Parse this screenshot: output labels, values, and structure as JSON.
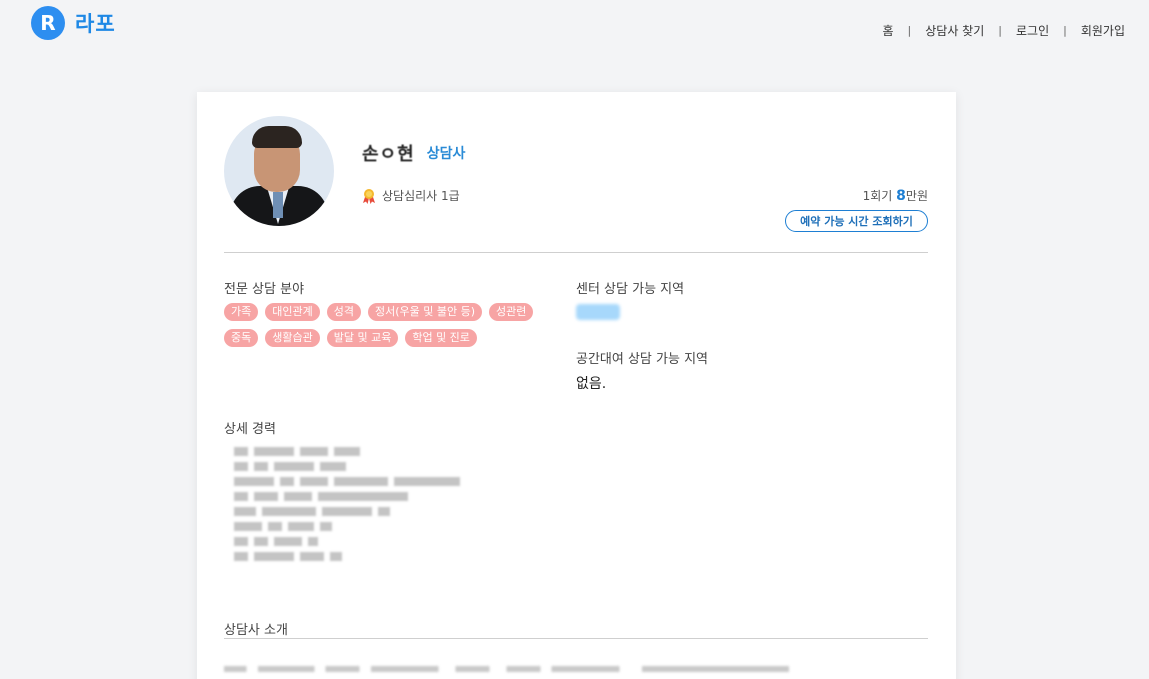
{
  "header": {
    "logo_mark": "R",
    "logo_text": "라포",
    "nav": [
      {
        "label": "홈"
      },
      {
        "label": "상담사 찾기"
      },
      {
        "label": "로그인"
      },
      {
        "label": "회원가입"
      }
    ],
    "separator": "|"
  },
  "profile": {
    "name": "손ㅇ현",
    "role": "상담사",
    "certificate": "상담심리사 1급",
    "price": {
      "prefix": "1회기 ",
      "amount": "8",
      "unit": "만원"
    },
    "reserve_button": "예약 가능 시간 조회하기"
  },
  "sections": {
    "specialty_title": "전문 상담 분야",
    "specialties": [
      "가족",
      "대인관계",
      "성격",
      "정서(우울 및 불안 등)",
      "성관련",
      "중독",
      "생활습관",
      "발달 및 교육",
      "학업 및 진로"
    ],
    "center_region_title": "센터 상담 가능 지역",
    "rental_region_title": "공간대여 상담 가능 지역",
    "rental_region_value": "없음.",
    "career_title": "상세 경력",
    "intro_title": "상담사 소개"
  },
  "colors": {
    "brand": "#2d8ef0",
    "accent_blue": "#1e7fd3",
    "tag_pink": "#f7a4a4",
    "region_chip": "#a7d8fb",
    "background": "#f3f4f6"
  },
  "icons": {
    "cert": "award-ribbon-icon"
  }
}
